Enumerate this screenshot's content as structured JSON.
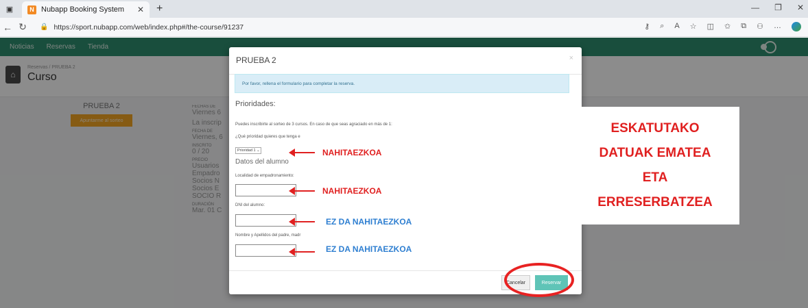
{
  "browser": {
    "tab_title": "Nubapp Booking System",
    "tab_favicon_letter": "N",
    "url": "https://sport.nubapp.com/web/index.php#/the-course/91237"
  },
  "app_nav": {
    "items": [
      "Noticias",
      "Reservas",
      "Tienda"
    ]
  },
  "page": {
    "breadcrumb": "Reservas / PRUEBA 2",
    "title": "Curso",
    "course_name": "PRUEBA 2",
    "join_button": "Apuntarme al sorteo",
    "info": [
      {
        "label": "FECHAS DE",
        "value": "Viernes 6"
      },
      {
        "label": "",
        "value": "La inscrip"
      },
      {
        "label": "FECHA DE",
        "value": "Viernes, 6"
      },
      {
        "label": "INSCRITO",
        "value": "0 / 20"
      },
      {
        "label": "PRECIO",
        "value": "Usuarios"
      },
      {
        "label": "",
        "value": "Empadro"
      },
      {
        "label": "",
        "value": "Socios N"
      },
      {
        "label": "",
        "value": "Socios E"
      },
      {
        "label": "",
        "value": "SOCIO R"
      },
      {
        "label": "DURACIÓN",
        "value": "Mar. 01 C"
      }
    ]
  },
  "modal": {
    "title": "PRUEBA 2",
    "close": "×",
    "alert": "Por favor, rellena el formulario para completar la reserva.",
    "priorities_heading": "Prioridades:",
    "priorities_text": "Puedes inscribirte al sorteo de 3 cursos. En caso de que seas agraciado en más de 1:",
    "priority_question": "¿Qué prioridad quieres que tenga e",
    "priority_select": "Prioridad 1",
    "student_heading": "Datos del alumno",
    "field1_label": "Localidad de empadronamiento:",
    "field2_label": "DNI del alumno:",
    "field3_label": "Nombre y Apellidos del padre, madr",
    "cancel_label": "Cancelar",
    "reserve_label": "Reservar"
  },
  "annotations": {
    "a1": "NAHITAEZKOA",
    "a2": "NAHITAEZKOA",
    "a3": "EZ DA NAHITAEZKOA",
    "a4": "EZ DA NAHITAEZKOA",
    "big": [
      "ESKATUTAKO",
      "DATUAK EMATEA",
      "ETA",
      "ERRESERBATZEA"
    ]
  }
}
